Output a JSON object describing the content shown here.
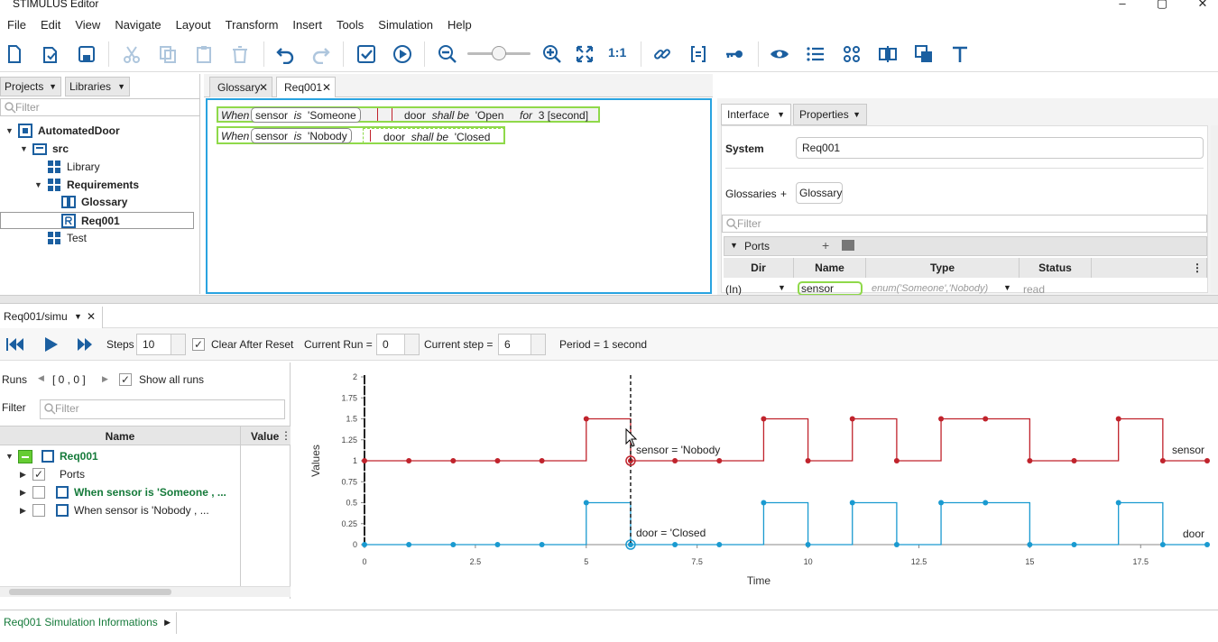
{
  "app": {
    "title": "STIMULUS Editor"
  },
  "menu": [
    "File",
    "Edit",
    "View",
    "Navigate",
    "Layout",
    "Transform",
    "Insert",
    "Tools",
    "Simulation",
    "Help"
  ],
  "toolbar": {
    "zoom_ratio": "1:1"
  },
  "left": {
    "tabs": [
      "Projects",
      "Libraries"
    ],
    "filter_placeholder": "Filter",
    "tree": [
      {
        "label": "AutomatedDoor",
        "bold": true
      },
      {
        "label": "src",
        "bold": true
      },
      {
        "label": "Library",
        "bold": false
      },
      {
        "label": "Requirements",
        "bold": true
      },
      {
        "label": "Glossary",
        "bold": true
      },
      {
        "label": "Req001",
        "bold": true
      },
      {
        "label": "Test",
        "bold": false
      }
    ]
  },
  "editor": {
    "tabs": [
      "Glossary",
      "Req001"
    ],
    "req1": {
      "when": "When",
      "sensor": "sensor",
      "is": "is",
      "val": "'Someone",
      "door": "door",
      "shall": "shall be",
      "open": "'Open",
      "for": "for",
      "dur": "3 [second]"
    },
    "req2": {
      "when": "When",
      "sensor": "sensor",
      "is": "is",
      "val": "'Nobody",
      "door": "door",
      "shall": "shall be",
      "closed": "'Closed"
    }
  },
  "right": {
    "tabs": [
      "Interface",
      "Properties"
    ],
    "system_label": "System",
    "system_value": "Req001",
    "glossaries_label": "Glossaries",
    "plus": "+",
    "glossary_btn": "Glossary",
    "filter_placeholder": "Filter",
    "ports_label": "Ports",
    "columns": [
      "Dir",
      "Name",
      "Type",
      "Status"
    ],
    "row": {
      "dir": "(In)",
      "name": "sensor",
      "type": "enum('Someone','Nobody)",
      "status": "read"
    }
  },
  "sim": {
    "tab": "Req001/simu",
    "steps_label": "Steps",
    "steps": "10",
    "clear_label": "Clear After Reset",
    "run_label": "Current Run =",
    "run": "0",
    "step_label": "Current step =",
    "step": "6",
    "period": "Period = 1 second",
    "runs_label": "Runs",
    "runs_range": "[ 0 , 0 ]",
    "show_all": "Show all runs",
    "filter_label": "Filter",
    "filter_placeholder": "Filter",
    "col_name": "Name",
    "col_value": "Value",
    "items": [
      {
        "label": "Req001",
        "green": true
      },
      {
        "label": "Ports",
        "green": false
      },
      {
        "label": "When  sensor is  'Someone , ...",
        "green": true
      },
      {
        "label": "When  sensor is  'Nobody , ...",
        "green": false
      }
    ]
  },
  "chart_data": {
    "type": "line",
    "xlabel": "Time",
    "ylabel": "Values",
    "xlim": [
      0,
      19
    ],
    "ylim": [
      0,
      2
    ],
    "x_ticks": [
      0,
      2.5,
      5,
      7.5,
      10,
      12.5,
      15,
      17.5
    ],
    "y_ticks": [
      0,
      0.25,
      0.5,
      0.75,
      1,
      1.25,
      1.5,
      1.75,
      2
    ],
    "series": [
      {
        "name": "sensor",
        "color": "#c0232c",
        "x": [
          0,
          1,
          2,
          3,
          4,
          5,
          6,
          7,
          8,
          9,
          10,
          11,
          12,
          13,
          14,
          15,
          16,
          17,
          18,
          19
        ],
        "values": [
          1,
          1,
          1,
          1,
          1,
          1.5,
          1,
          1,
          1,
          1.5,
          1,
          1.5,
          1,
          1.5,
          1.5,
          1,
          1,
          1.5,
          1,
          1
        ]
      },
      {
        "name": "door",
        "color": "#1a9ad0",
        "x": [
          0,
          1,
          2,
          3,
          4,
          5,
          6,
          7,
          8,
          9,
          10,
          11,
          12,
          13,
          14,
          15,
          16,
          17,
          18,
          19
        ],
        "values": [
          0,
          0,
          0,
          0,
          0,
          0.5,
          0,
          0,
          0,
          0.5,
          0,
          0.5,
          0,
          0.5,
          0.5,
          0,
          0,
          0.5,
          0,
          0
        ]
      }
    ],
    "cursor_x": 6,
    "annotations": [
      "sensor = 'Nobody",
      "door = 'Closed"
    ]
  },
  "bottom": {
    "tab": "Req001 Simulation Informations"
  }
}
